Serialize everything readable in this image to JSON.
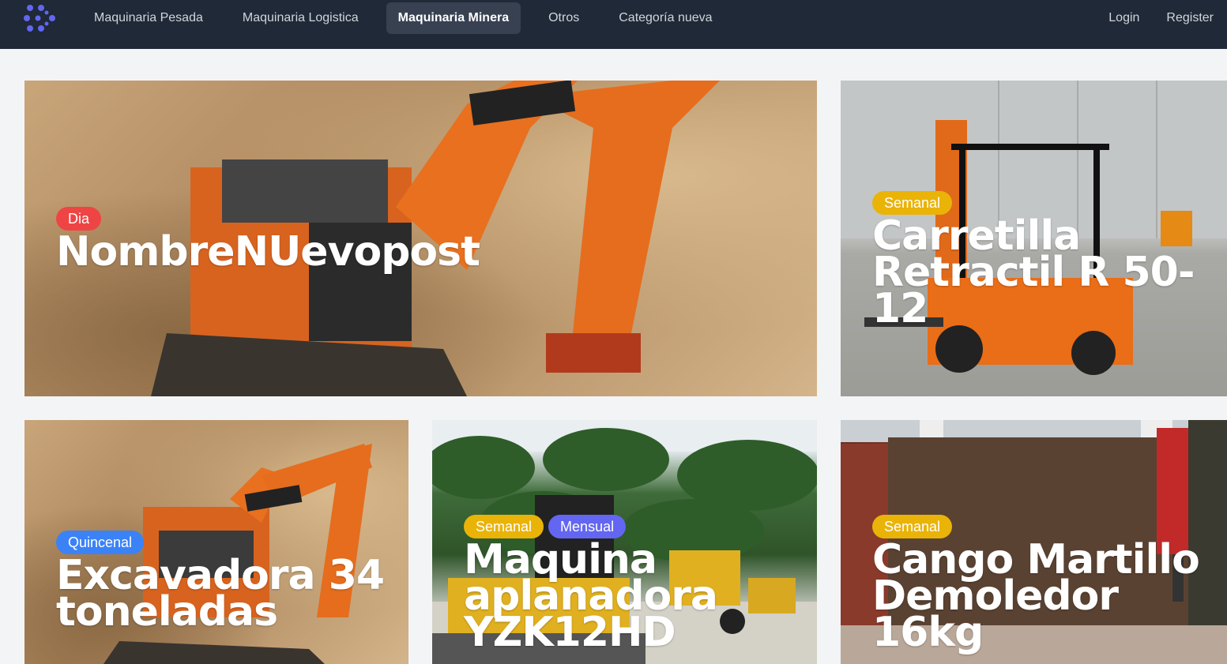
{
  "nav": {
    "links": [
      "Maquinaria Pesada",
      "Maquinaria Logistica",
      "Maquinaria Minera",
      "Otros",
      "Categoría nueva"
    ],
    "active_index": 2,
    "login": "Login",
    "register": "Register"
  },
  "colors": {
    "navbar": "#1f2937",
    "badge_dia": "#ef4444",
    "badge_semanal": "#eab308",
    "badge_quincenal": "#3b82f6",
    "badge_mensual": "#6366f1"
  },
  "cards": [
    {
      "title": "NombreNUevopost",
      "badges": [
        "Dia"
      ],
      "image": "orange-excavator-photo"
    },
    {
      "title": "Carretilla Retractil R 50-12",
      "badges": [
        "Semanal"
      ],
      "image": "orange-forklift-photo"
    },
    {
      "title": "Excavadora 34 toneladas",
      "badges": [
        "Quincenal"
      ],
      "image": "orange-excavator-photo"
    },
    {
      "title": "Maquina aplanadora YZK12HD",
      "badges": [
        "Semanal",
        "Mensual"
      ],
      "image": "road-roller-palms-photo"
    },
    {
      "title": "Cango Martillo Demoledor 16kg",
      "badges": [
        "Semanal"
      ],
      "image": "demolition-hammer-photo"
    }
  ]
}
